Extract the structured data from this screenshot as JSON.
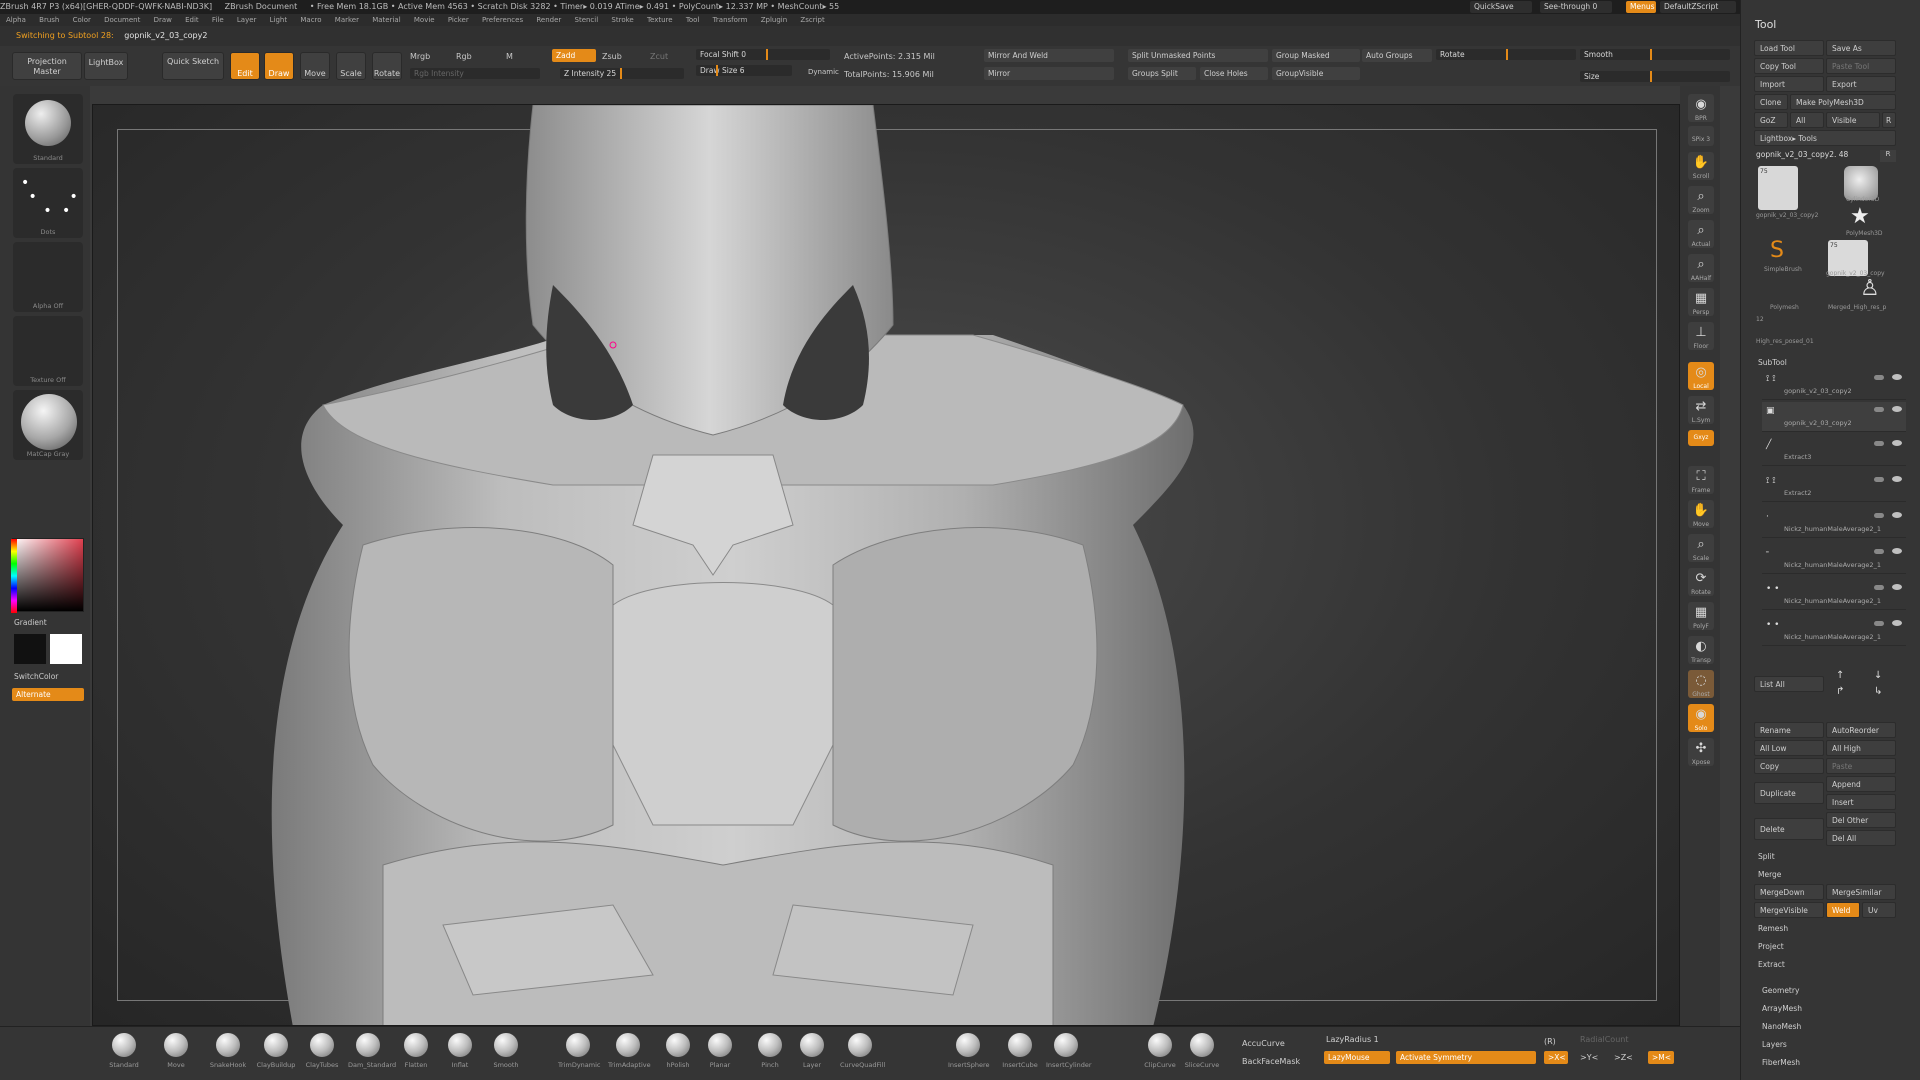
{
  "app": {
    "titlebar": [
      "ZBrush 4R7 P3 (x64)[GHER-QDDF-QWFK-NABI-ND3K]",
      "ZBrush Document",
      "• Free Mem 18.1GB • Active Mem 4563 • Scratch Disk 3282 • Timer▸ 0.019 ATime▸ 0.491 • PolyCount▸ 12.337 MP • MeshCount▸ 55"
    ],
    "quicksave": "QuickSave",
    "seethrough": "See-through  0",
    "menus_btn": "Menus",
    "script": "DefaultZScript"
  },
  "menu": [
    "Alpha",
    "Brush",
    "Color",
    "Document",
    "Draw",
    "Edit",
    "File",
    "Layer",
    "Light",
    "Macro",
    "Marker",
    "Material",
    "Movie",
    "Picker",
    "Preferences",
    "Render",
    "Stencil",
    "Stroke",
    "Texture",
    "Tool",
    "Transform",
    "Zplugin",
    "Zscript"
  ],
  "notice": {
    "text": "Switching to Subtool 28:",
    "name": "gopnik_v2_03_copy2"
  },
  "topbar": {
    "projection_master": "Projection Master",
    "lightbox": "LightBox",
    "quick_sketch": "Quick Sketch",
    "edit": "Edit",
    "draw": "Draw",
    "move": "Move",
    "scale": "Scale",
    "rotate": "Rotate",
    "mrgb": "Mrgb",
    "rgb": "Rgb",
    "m": "M",
    "rgb_intensity": "Rgb Intensity",
    "zadd": "Zadd",
    "zsub": "Zsub",
    "zcut": "Zcut",
    "z_intensity": "Z Intensity 25",
    "focal_shift": "Focal Shift 0",
    "draw_size": "Draw Size 6",
    "dynamic": "Dynamic",
    "active_points": "ActivePoints: 2.315 Mil",
    "total_points": "TotalPoints: 15.906 Mil",
    "mirror_weld": "Mirror And Weld",
    "mirror": "Mirror",
    "split_unmasked": "Split Unmasked Points",
    "groups_split": "Groups Split",
    "close_holes": "Close Holes",
    "group_masked": "Group Masked",
    "auto_groups": "Auto Groups",
    "group_visible": "GroupVisible",
    "rotate_slider": "Rotate",
    "smooth": "Smooth",
    "size": "Size"
  },
  "leftshelf": {
    "brush": "Standard",
    "stroke": "Dots",
    "alpha": "Alpha  Off",
    "texture": "Texture  Off",
    "material": "MatCap Gray",
    "gradient": "Gradient",
    "switchcolor": "SwitchColor",
    "alternate": "Alternate"
  },
  "rightbar": [
    "BPR",
    "SPix 3",
    "Scroll",
    "Zoom",
    "Actual",
    "AAHalf",
    "Persp",
    "Floor",
    "Local",
    "L.Sym",
    "Gxyz",
    "Frame",
    "Move",
    "Scale",
    "Rotate",
    "PolyF",
    "Transp",
    "Ghost",
    "Solo",
    "Xpose"
  ],
  "toolpanel": {
    "title": "Tool",
    "load_tool": "Load Tool",
    "save_as": "Save As",
    "copy_tool": "Copy Tool",
    "paste_tool": "Paste Tool",
    "import": "Import",
    "export": "Export",
    "clone": "Clone",
    "make_polymesh": "Make PolyMesh3D",
    "goz": "GoZ",
    "all": "All",
    "visible": "Visible",
    "r": "R",
    "lightbox_tools": "Lightbox▸ Tools",
    "current_tool": "gopnik_v2_03_copy2. 48",
    "thumbs": [
      "gopnik_v2_03_copy2",
      "Cylinder3D",
      "PolyMesh3D",
      "SimpleBrush",
      "gopnik_v2_03_copy",
      "Polymesh",
      "Merged_High_res_p",
      "High_res_posed_01"
    ],
    "thumb_counts": [
      "75",
      "75",
      "12"
    ],
    "subtool_title": "SubTool",
    "subtools": [
      "gopnik_v2_03_copy2",
      "gopnik_v2_03_copy2",
      "Extract3",
      "Extract2",
      "Nickz_humanMaleAverage2_1",
      "Nickz_humanMaleAverage2_1",
      "Nickz_humanMaleAverage2_1",
      "Nickz_humanMaleAverage2_1"
    ],
    "list_all": "List  All",
    "rename": "Rename",
    "autoreorder": "AutoReorder",
    "all_low": "All Low",
    "all_high": "All High",
    "copy": "Copy",
    "paste": "Paste",
    "append": "Append",
    "duplicate": "Duplicate",
    "insert": "Insert",
    "del_other": "Del Other",
    "delete": "Delete",
    "del_all": "Del All",
    "split": "Split",
    "merge": "Merge",
    "mergedown": "MergeDown",
    "mergesimilar": "MergeSimilar",
    "mergevisible": "MergeVisible",
    "weld": "Weld",
    "uv": "Uv",
    "remesh": "Remesh",
    "project": "Project",
    "extract": "Extract",
    "geometry": "Geometry",
    "arraymesh": "ArrayMesh",
    "nanomesh": "NanoMesh",
    "layers": "Layers",
    "fibermesh": "FiberMesh"
  },
  "brushes": [
    "Standard",
    "Move",
    "SnakeHook",
    "ClayBuildup",
    "ClayTubes",
    "Dam_Standard",
    "Flatten",
    "Inflat",
    "Smooth",
    "TrimDynamic",
    "TrimAdaptive",
    "hPolish",
    "Planar",
    "Pinch",
    "Layer",
    "CurveQuadFill",
    "InsertSphere",
    "InsertCube",
    "InsertCylinder",
    "ClipCurve",
    "SliceCurve"
  ],
  "bottom": {
    "accucurve": "AccuCurve",
    "backfacemask": "BackFaceMask",
    "lazyradius": "LazyRadius 1",
    "lazymouse": "LazyMouse",
    "activate_symmetry": "Activate Symmetry",
    "r_toggle": "(R)",
    "radialcount": "RadialCount",
    "axis_x": ">X<",
    "axis_y": ">Y<",
    "axis_z": ">Z<",
    "axis_m": ">M<"
  },
  "colors": {
    "accent": "#e48a18",
    "panel": "#353535",
    "mesh": "#c8c8c8"
  }
}
